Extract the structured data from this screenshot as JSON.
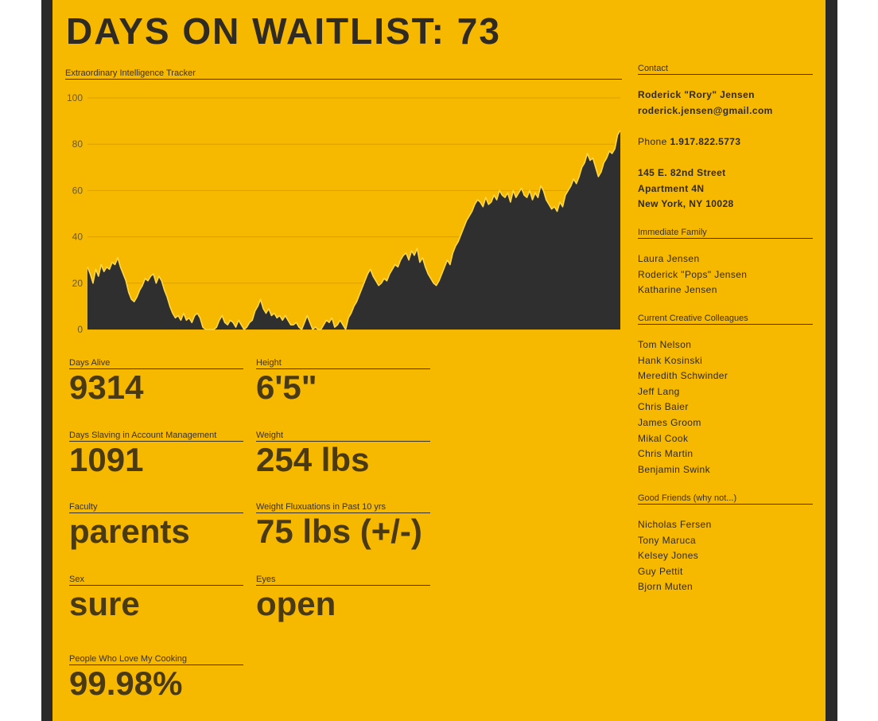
{
  "title": "DAYS ON WAITLIST: 73",
  "colors": {
    "background": "#f7b800",
    "frame": "#2a2a2a",
    "area_fill": "#2f2f2f",
    "area_stroke": "#ffd84a",
    "text": "#2f2a22"
  },
  "chart_data": {
    "type": "area",
    "title": "Extraordinary Intelligence Tracker",
    "xlabel": "",
    "ylabel": "",
    "ylim": [
      0,
      100
    ],
    "yticks": [
      "0",
      "20",
      "40",
      "60",
      "80",
      "100"
    ],
    "grid": true,
    "series": [
      {
        "values": [
          27,
          24,
          20,
          26,
          23,
          28,
          25,
          27,
          26,
          29,
          28,
          31,
          27,
          24,
          21,
          16,
          13,
          12,
          14,
          17,
          19,
          22,
          21,
          23,
          24,
          20,
          23,
          21,
          17,
          14,
          10,
          7,
          5,
          6,
          4,
          7,
          4,
          5,
          3,
          6,
          7,
          5,
          1,
          0,
          0,
          0,
          0,
          1,
          4,
          6,
          3,
          2,
          4,
          3,
          1,
          4,
          2,
          0,
          1,
          3,
          4,
          8,
          10,
          13,
          9,
          7,
          9,
          6,
          7,
          5,
          6,
          4,
          6,
          4,
          2,
          2,
          3,
          1,
          0,
          3,
          6,
          3,
          0,
          1,
          0,
          0,
          2,
          4,
          3,
          5,
          1,
          2,
          4,
          2,
          0,
          5,
          7,
          10,
          12,
          15,
          18,
          21,
          24,
          26,
          23,
          21,
          19,
          20,
          22,
          21,
          24,
          26,
          28,
          27,
          30,
          32,
          33,
          30,
          34,
          32,
          35,
          29,
          31,
          27,
          24,
          22,
          20,
          19,
          21,
          24,
          27,
          30,
          28,
          33,
          36,
          38,
          41,
          44,
          47,
          49,
          51,
          54,
          56,
          55,
          53,
          57,
          54,
          55,
          58,
          56,
          60,
          58,
          57,
          59,
          55,
          60,
          57,
          59,
          61,
          58,
          57,
          60,
          56,
          59,
          57,
          62,
          60,
          56,
          54,
          52,
          53,
          51,
          55,
          53,
          58,
          60,
          62,
          65,
          63,
          66,
          70,
          72,
          76,
          73,
          74,
          70,
          66,
          68,
          72,
          74,
          77,
          76,
          78,
          84,
          86
        ]
      }
    ]
  },
  "stats": {
    "days_alive_label": "Days Alive",
    "days_alive": "9314",
    "height_label": "Height",
    "height": "6'5\"",
    "days_slaving_label": "Days Slaving in Account Management",
    "days_slaving": "1091",
    "weight_label": "Weight",
    "weight": "254 lbs",
    "faculty_label": "Faculty",
    "faculty": "parents",
    "weight_fluct_label": "Weight Fluxuations in Past 10 yrs",
    "weight_fluct": "75 lbs (+/-)",
    "sex_label": "Sex",
    "sex": "sure",
    "eyes_label": "Eyes",
    "eyes": "open",
    "cooking_label": "People Who Love My Cooking",
    "cooking": "99.98%"
  },
  "sidebar": {
    "contact": {
      "header": "Contact",
      "name": "Roderick \"Rory\" Jensen",
      "email": "roderick.jensen@gmail.com",
      "phone_label": "Phone",
      "phone": "1.917.822.5773",
      "address1": "145 E. 82nd Street",
      "address2": "Apartment 4N",
      "address3": "New York, NY 10028"
    },
    "family": {
      "header": "Immediate Family",
      "items": [
        "Laura Jensen",
        "Roderick \"Pops\" Jensen",
        "Katharine Jensen"
      ]
    },
    "colleagues": {
      "header": "Current Creative Colleagues",
      "items": [
        "Tom Nelson",
        "Hank Kosinski",
        "Meredith Schwinder",
        "Jeff Lang",
        "Chris Baier",
        "James Groom",
        "Mikal Cook",
        "Chris Martin",
        "Benjamin Swink"
      ]
    },
    "friends": {
      "header": "Good Friends (why not...)",
      "items": [
        "Nicholas Fersen",
        "Tony Maruca",
        "Kelsey Jones",
        "Guy Pettit",
        "Bjorn Muten"
      ]
    }
  }
}
